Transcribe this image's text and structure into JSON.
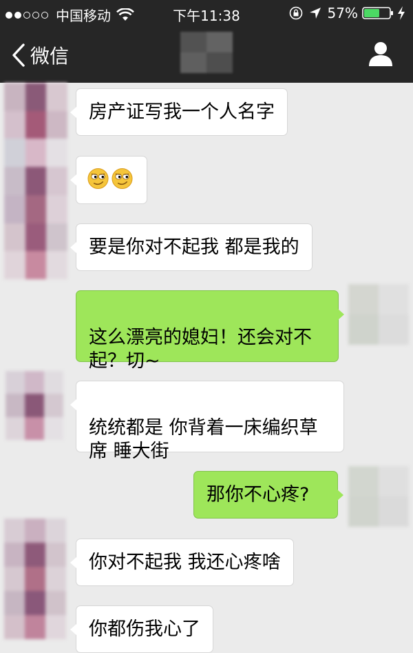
{
  "status_bar": {
    "carrier": "中国移动",
    "time": "下午11:38",
    "battery": "57%",
    "signal_bars_full": 2,
    "signal_bars_total": 5
  },
  "nav": {
    "back_label": "微信",
    "contact_name_blurred": true
  },
  "messages": [
    {
      "direction": "in",
      "text": "房产证写我一个人名字"
    },
    {
      "direction": "in",
      "emoji": [
        "smug-face-icon",
        "smug-face-icon"
      ]
    },
    {
      "direction": "in",
      "text": "要是你对不起我 都是我的"
    },
    {
      "direction": "out",
      "text": "这么漂亮的媳妇！还会对不\n起？切~"
    },
    {
      "direction": "in",
      "text": "统统都是 你背着一床编织草\n席 睡大街"
    },
    {
      "direction": "out",
      "text": "那你不心疼?"
    },
    {
      "direction": "in",
      "text": "你对不起我 我还心疼啥"
    },
    {
      "direction": "in",
      "text": "你都伤我心了"
    }
  ],
  "colors": {
    "header_bg": "#262626",
    "chat_bg": "#ebebeb",
    "incoming_bubble": "#ffffff",
    "outgoing_bubble": "#9ee65a",
    "battery_fill": "#4cd964"
  }
}
